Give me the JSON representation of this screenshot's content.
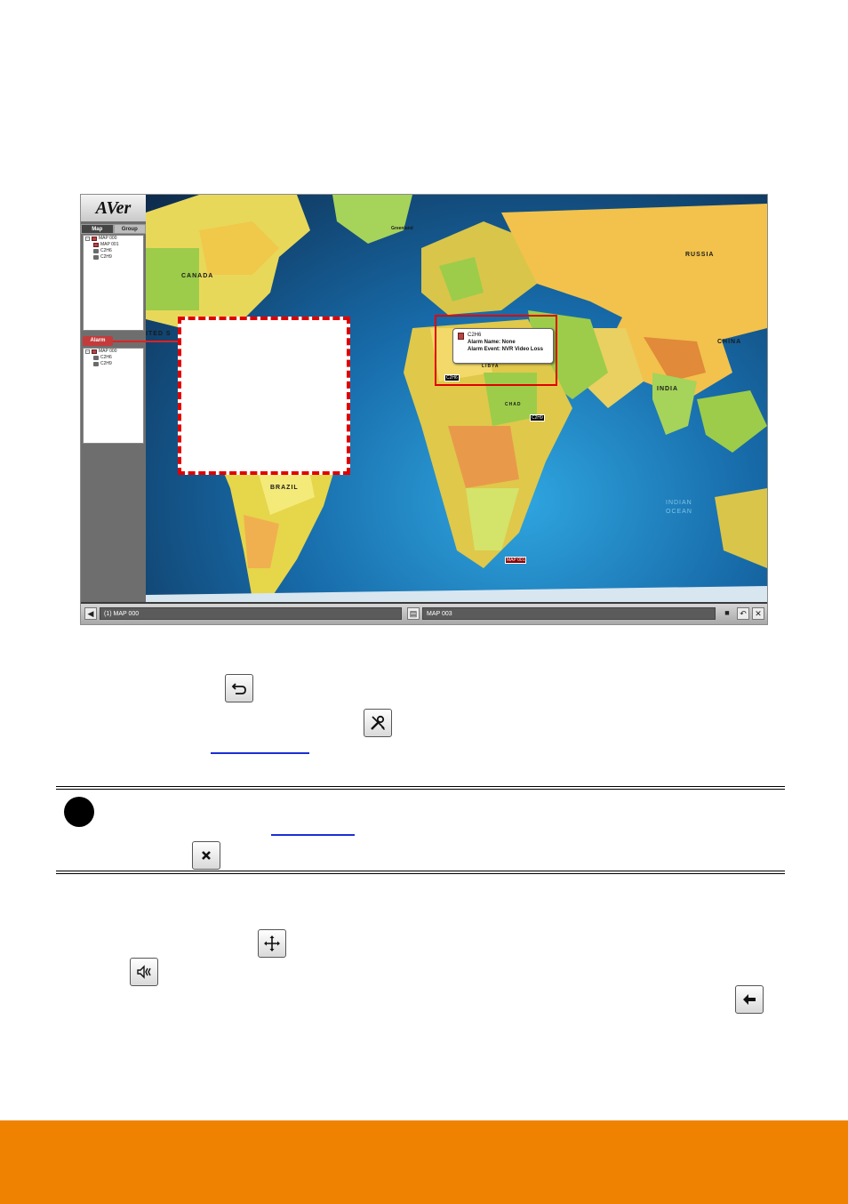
{
  "app": {
    "logo": "AVer",
    "tabs": [
      "Map",
      "Group"
    ],
    "map_tree": [
      {
        "label": "MAP 000",
        "kind": "map",
        "depth": 0
      },
      {
        "label": "MAP 001",
        "kind": "map",
        "depth": 1
      },
      {
        "label": "C2H6",
        "kind": "camera",
        "depth": 1
      },
      {
        "label": "C2H9",
        "kind": "camera",
        "depth": 1
      }
    ],
    "alarm_label": "Alarm",
    "alarm_tree": [
      {
        "label": "MAP 000",
        "kind": "map",
        "depth": 0
      },
      {
        "label": "C2H6",
        "kind": "camera",
        "depth": 1
      },
      {
        "label": "C2H9",
        "kind": "camera",
        "depth": 1
      }
    ],
    "map": {
      "labels": {
        "canada": "CANADA",
        "russia": "RUSSIA",
        "china": "CHINA",
        "india": "INDIA",
        "brazil": "BRAZIL",
        "libya": "LIBYA",
        "chad": "CHAD",
        "greenland": "Greenland",
        "indian_ocean": "INDIAN OCEAN",
        "united_states": "ITED S"
      },
      "popup": {
        "title": "C2H6",
        "line1": "Alarm Name: None",
        "line2": "Alarm Event: NVR Video Loss"
      },
      "markers": {
        "c2h6": "C2H6",
        "c2h9": "C2H9",
        "map001": "MAP 001"
      }
    },
    "bottom_bar": {
      "left_field": "(1) MAP 000",
      "right_field": "MAP 003"
    }
  },
  "icons": {
    "back": "back-arrow-icon",
    "tools": "tools-icon",
    "close": "close-icon",
    "move": "move-icon",
    "sound": "speaker-icon",
    "left": "left-arrow-icon"
  },
  "colors": {
    "alarm_red": "#e00000",
    "footer_orange": "#ef8200",
    "link_blue": "#1a2fd6"
  }
}
